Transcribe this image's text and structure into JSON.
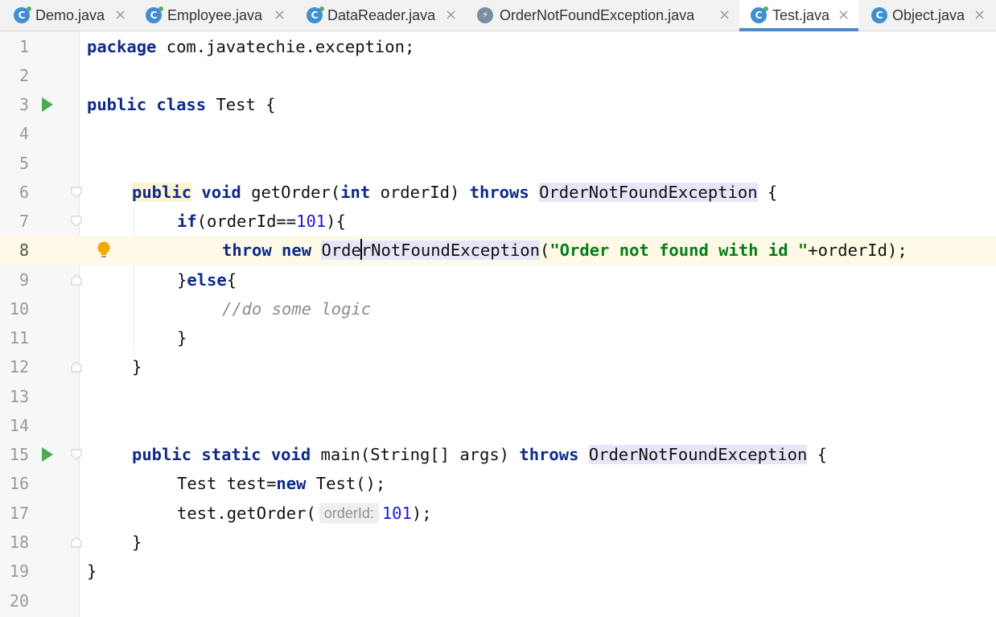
{
  "tabs": [
    {
      "label": "Demo.java",
      "icon": "class-icon",
      "close": "×"
    },
    {
      "label": "Employee.java",
      "icon": "class-icon",
      "close": "×"
    },
    {
      "label": "DataReader.java",
      "icon": "class-icon",
      "close": "×"
    },
    {
      "label": "OrderNotFoundException.java",
      "icon": "exception-class-icon",
      "close": "×"
    },
    {
      "label": "Test.java",
      "icon": "class-icon",
      "close": "×",
      "active": true
    },
    {
      "label": "Object.java",
      "icon": "class-icon",
      "close": "×"
    }
  ],
  "icon_glyphs": {
    "class": "C",
    "exception": "⚡"
  },
  "lines": [
    {
      "n": "1",
      "a": "package",
      "b": " com.javatechie.exception;"
    },
    {
      "n": "2"
    },
    {
      "n": "3",
      "a": "public",
      "b": " ",
      "c": "class",
      "d": " Test {"
    },
    {
      "n": "4"
    },
    {
      "n": "5"
    },
    {
      "n": "6",
      "a": "public",
      "b": " ",
      "c": "void",
      "d": " getOrder(",
      "e": "int",
      "f": " orderId) ",
      "g": "throws",
      "h": " ",
      "i": "OrderNotFoundException",
      "j": " {"
    },
    {
      "n": "7",
      "a": "if",
      "b": "(orderId==",
      "c": "101",
      "d": "){"
    },
    {
      "n": "8",
      "a": "throw",
      "b": " n",
      "c": "e",
      "d": "w",
      "e": " ",
      "f": "Orde",
      "g": "rNotFoundException",
      "h": "(",
      "i": "\"Order not found with id \"",
      "j": "+orderId);"
    },
    {
      "n": "9",
      "a": "}",
      "b": "else",
      "c": "{"
    },
    {
      "n": "10",
      "a": "//do some logic"
    },
    {
      "n": "11",
      "a": "}"
    },
    {
      "n": "12",
      "a": "}"
    },
    {
      "n": "13"
    },
    {
      "n": "14"
    },
    {
      "n": "15",
      "a": "public",
      "b": " ",
      "c": "static",
      "d": " ",
      "e": "void",
      "f": " main(String[] args) ",
      "g": "throws",
      "h": " ",
      "i": "OrderNotFoundException",
      "j": " {"
    },
    {
      "n": "16",
      "a": "Test test=",
      "b": "new",
      "c": " Test();"
    },
    {
      "n": "17",
      "a": "test.getOrder(",
      "b": "orderId:",
      "c": "101",
      "d": ");"
    },
    {
      "n": "18",
      "a": "}"
    },
    {
      "n": "19",
      "a": "}"
    },
    {
      "n": "20"
    }
  ],
  "colors": {
    "keyword": "#0d2a8a",
    "number": "#1a1ad6",
    "string": "#067d17",
    "comment": "#8c8c8c",
    "current_line": "#fefae7",
    "run_gutter": "#4caa59",
    "active_tab_underline": "#4a88c7"
  }
}
